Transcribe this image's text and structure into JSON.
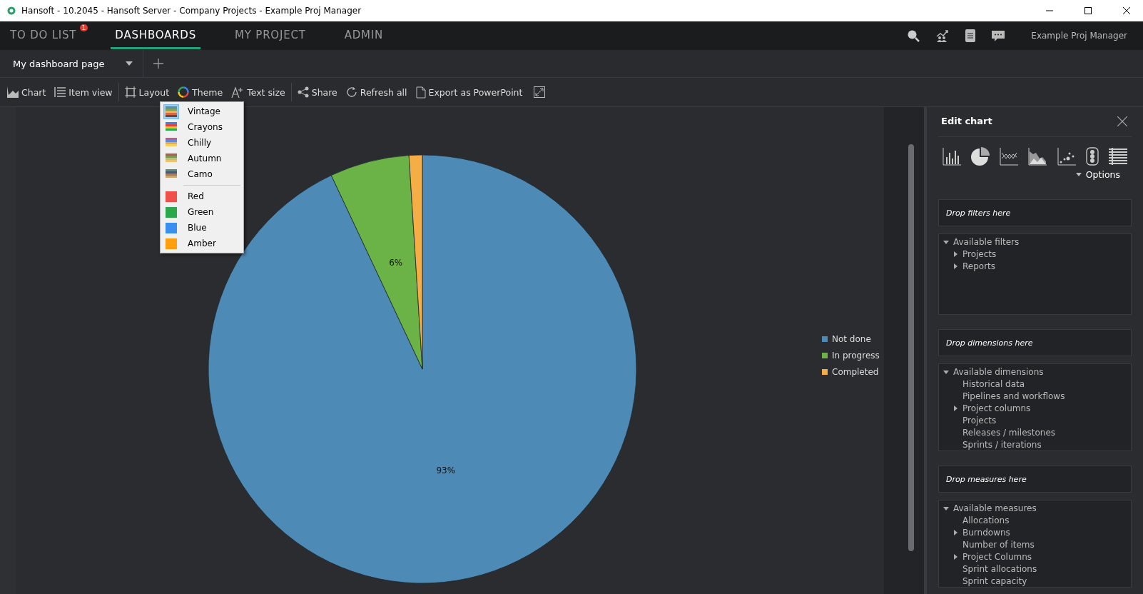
{
  "window": {
    "title": "Hansoft - 10.2045 - Hansoft Server - Company Projects - Example Proj Manager"
  },
  "nav": {
    "tabs": [
      {
        "label": "TO DO LIST",
        "selected": false,
        "badge": "1"
      },
      {
        "label": "DASHBOARDS",
        "selected": true
      },
      {
        "label": "MY PROJECT",
        "selected": false
      },
      {
        "label": "ADMIN",
        "selected": false
      }
    ],
    "user": "Example Proj Manager"
  },
  "page_tab": {
    "label": "My dashboard page"
  },
  "toolbar": [
    {
      "label": "Chart"
    },
    {
      "label": "Item view"
    },
    {
      "label": "Layout"
    },
    {
      "label": "Theme"
    },
    {
      "label": "Text size"
    },
    {
      "label": "Share"
    },
    {
      "label": "Refresh all"
    },
    {
      "label": "Export as PowerPoint"
    }
  ],
  "theme_menu": [
    {
      "kind": "palette",
      "label": "Vintage",
      "selected": true,
      "stripes": [
        {
          "color": "#5b8bab"
        },
        {
          "color": "#7aa05a"
        },
        {
          "color": "#f2b34b"
        },
        {
          "color": "#d9654a"
        },
        {
          "color": "#6b4a3a"
        }
      ]
    },
    {
      "kind": "palette",
      "label": "Crayons",
      "selected": false,
      "stripes": [
        {
          "color": "#3b82e6"
        },
        {
          "color": "#e8433a"
        },
        {
          "color": "#f6c21b"
        },
        {
          "color": "#2daa4a"
        }
      ]
    },
    {
      "kind": "palette",
      "label": "Chilly",
      "selected": false,
      "stripes": [
        {
          "color": "#c8558e"
        },
        {
          "color": "#5a8fd8"
        },
        {
          "color": "#f2a54a"
        },
        {
          "color": "#f5d05a"
        }
      ]
    },
    {
      "kind": "palette",
      "label": "Autumn",
      "selected": false,
      "stripes": [
        {
          "color": "#b8574a"
        },
        {
          "color": "#7a9a5a"
        },
        {
          "color": "#b8c07a"
        },
        {
          "color": "#f0c36a"
        }
      ]
    },
    {
      "kind": "palette",
      "label": "Camo",
      "selected": false,
      "stripes": [
        {
          "color": "#5c8a7a"
        },
        {
          "color": "#4a5a6a"
        },
        {
          "color": "#a87a5a"
        },
        {
          "color": "#c8a870"
        }
      ]
    },
    {
      "kind": "solid",
      "label": "Red",
      "selected": false,
      "color": "#f0504a"
    },
    {
      "kind": "solid",
      "label": "Green",
      "selected": false,
      "color": "#2aa84a"
    },
    {
      "kind": "solid",
      "label": "Blue",
      "selected": false,
      "color": "#3a8ef0"
    },
    {
      "kind": "solid",
      "label": "Amber",
      "selected": false,
      "color": "#ff9f10"
    }
  ],
  "chart": {
    "chart_data": {
      "type": "pie",
      "categories": [
        "Not done",
        "In progress",
        "Completed"
      ],
      "values": [
        93,
        6,
        1
      ],
      "value_labels": [
        "93%",
        "6%",
        null
      ],
      "legend": "right"
    },
    "slice_colors": [
      {
        "color": "#4d8ab5"
      },
      {
        "color": "#6cb347"
      },
      {
        "color": "#f5ad45"
      }
    ]
  },
  "edit_panel": {
    "title": "Edit chart",
    "options": "Options",
    "sections": [
      {
        "drop": "Drop filters here",
        "tree": {
          "label": "Available filters",
          "expanded": true,
          "children": [
            {
              "label": "Projects",
              "expandable": true
            },
            {
              "label": "Reports",
              "expandable": true
            }
          ]
        }
      },
      {
        "drop": "Drop dimensions here",
        "tree": {
          "label": "Available dimensions",
          "expanded": true,
          "children": [
            {
              "label": "Historical data",
              "expandable": false
            },
            {
              "label": "Pipelines and workflows",
              "expandable": false
            },
            {
              "label": "Project columns",
              "expandable": true
            },
            {
              "label": "Projects",
              "expandable": false
            },
            {
              "label": "Releases / milestones",
              "expandable": false
            },
            {
              "label": "Sprints / iterations",
              "expandable": false
            }
          ]
        }
      },
      {
        "drop": "Drop measures here",
        "tree": {
          "label": "Available measures",
          "expanded": true,
          "children": [
            {
              "label": "Allocations",
              "expandable": false
            },
            {
              "label": "Burndowns",
              "expandable": true
            },
            {
              "label": "Number of items",
              "expandable": false
            },
            {
              "label": "Project Columns",
              "expandable": true
            },
            {
              "label": "Sprint allocations",
              "expandable": false
            },
            {
              "label": "Sprint capacity",
              "expandable": false
            }
          ]
        }
      }
    ]
  }
}
